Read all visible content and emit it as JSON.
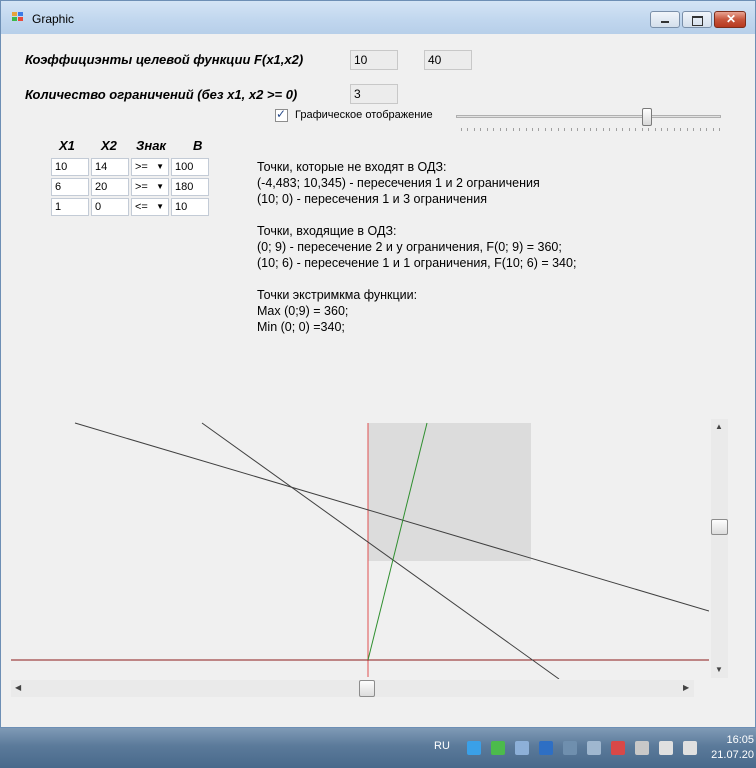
{
  "window": {
    "title": "Graphic"
  },
  "objective": {
    "label": "Коэффициэнты целевой функции F(x1,x2)",
    "c1": "10",
    "c2": "40"
  },
  "constraints_count": {
    "label": "Количество ограничений (без x1, x2 >= 0)",
    "value": "3"
  },
  "graphic_toggle": {
    "label": "Графическое отображение",
    "checked": true
  },
  "slider": {
    "level": 0.72
  },
  "table": {
    "headers": [
      "X1",
      "X2",
      "Знак",
      "B"
    ],
    "rows": [
      [
        "10",
        "14",
        ">=",
        "100"
      ],
      [
        "6",
        "20",
        ">=",
        "180"
      ],
      [
        "1",
        "0",
        "<=",
        "10"
      ]
    ]
  },
  "results": {
    "lines": [
      "Точки, которые не входят в ОДЗ:",
      "(-4,483; 10,345) - пересечения 1 и 2 ограничения",
      "(10; 0) - пересечения 1 и 3 ограничения",
      "",
      "Точки, входящие в ОДЗ:",
      "(0; 9) - пересечение 2 и y ограничения, F(0; 9) = 360;",
      "(10; 6) - пересечение 1 и 1 ограничения, F(10; 6) = 340;",
      "",
      "Точки экстримкма функции:",
      "Max (0;9) = 360;",
      "Min (0; 0) =340;"
    ]
  },
  "plot": {
    "region_color": "#dcdcdc",
    "axis_y_color": "#e05050",
    "axis_x_color": "#8b1a1a",
    "objective_color": "#2f8f2f",
    "constraint_color": "#404040"
  },
  "scrollbars": {
    "vertical_level": 0.37,
    "horizontal_level": 0.51
  },
  "taskbar": {
    "language": "RU",
    "time": "16:05",
    "date": "21.07.20",
    "icons": [
      "network-shield-icon",
      "antivirus-icon",
      "connection-icon",
      "monitor-icon",
      "network-icon",
      "safe-remove-icon",
      "flag-icon",
      "printer-icon",
      "signal-icon",
      "volume-icon"
    ]
  }
}
